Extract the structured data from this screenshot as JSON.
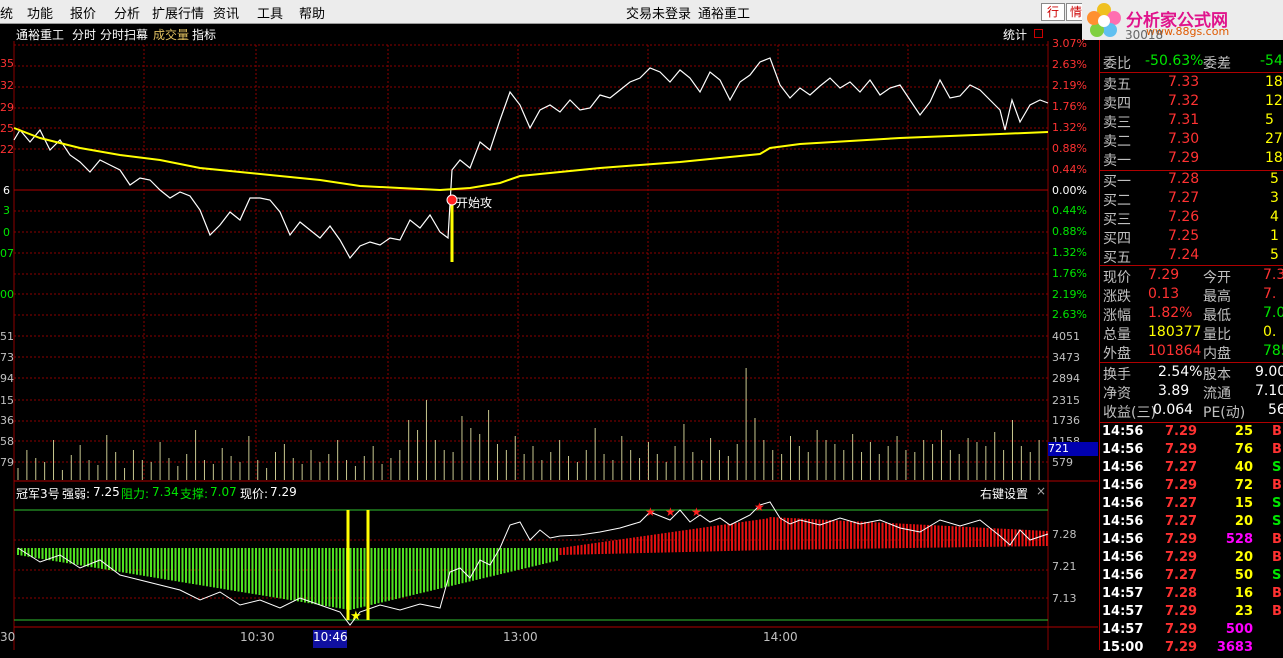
{
  "menu": {
    "items": [
      "统",
      "功能",
      "报价",
      "分析",
      "扩展行情",
      "资讯",
      "工具",
      "帮助"
    ],
    "center_text": [
      "交易未登录",
      "通裕重工"
    ],
    "tabs": [
      "行",
      "情"
    ]
  },
  "logo": {
    "text": "分析家公式网",
    "url": "www.88gs.com"
  },
  "chart_header": {
    "stock": "通裕重工",
    "buttons": [
      "分时",
      "分时扫幕",
      "成交量",
      "指标"
    ],
    "stats": "统计",
    "partial_code": "30018"
  },
  "price_axis": {
    "left": [
      "35",
      "32",
      "29",
      "25",
      "22",
      "6",
      "3",
      "0",
      "07",
      "00"
    ],
    "right": [
      "3.07%",
      "2.63%",
      "2.19%",
      "1.76%",
      "1.32%",
      "0.88%",
      "0.44%",
      "0.00%",
      "0.44%",
      "0.88%",
      "1.32%",
      "1.76%",
      "2.19%",
      "2.63%"
    ]
  },
  "volume_axis": {
    "left": [
      "51",
      "73",
      "94",
      "15",
      "36",
      "58",
      "79"
    ],
    "right": [
      "4051",
      "3473",
      "2894",
      "2315",
      "1736",
      "1158",
      "579"
    ],
    "highlight": "721"
  },
  "annotation": {
    "text": "开始攻"
  },
  "indicator": {
    "name": "冠军3号",
    "strength_label": "强弱:",
    "strength": "7.25",
    "resistance_label": "阻力:",
    "resistance": "7.34",
    "support_label": "支撑:",
    "support": "7.07",
    "price_label": "现价:",
    "price": "7.29",
    "settings": "右键设置",
    "close": "×",
    "axis": [
      "7.28",
      "7.21",
      "7.13"
    ]
  },
  "time_axis": {
    "labels": [
      "30",
      "10:30",
      "10:46",
      "13:00",
      "14:00"
    ]
  },
  "quote": {
    "ratio_row": {
      "label1": "委比",
      "value1": "-50.63%",
      "label2": "委差",
      "value2": "-54"
    },
    "sells": [
      {
        "label": "卖五",
        "price": "7.33",
        "vol": "18"
      },
      {
        "label": "卖四",
        "price": "7.32",
        "vol": "12"
      },
      {
        "label": "卖三",
        "price": "7.31",
        "vol": "5"
      },
      {
        "label": "卖二",
        "price": "7.30",
        "vol": "27"
      },
      {
        "label": "卖一",
        "price": "7.29",
        "vol": "18"
      }
    ],
    "buys": [
      {
        "label": "买一",
        "price": "7.28",
        "vol": "5"
      },
      {
        "label": "买二",
        "price": "7.27",
        "vol": "3"
      },
      {
        "label": "买三",
        "price": "7.26",
        "vol": "4"
      },
      {
        "label": "买四",
        "price": "7.25",
        "vol": "1"
      },
      {
        "label": "买五",
        "price": "7.24",
        "vol": "5"
      }
    ],
    "stats": [
      {
        "l1": "现价",
        "v1": "7.29",
        "l2": "今开",
        "v2": "7.3"
      },
      {
        "l1": "涨跌",
        "v1": "0.13",
        "l2": "最高",
        "v2": "7."
      },
      {
        "l1": "涨幅",
        "v1": "1.82%",
        "l2": "最低",
        "v2": "7.0"
      },
      {
        "l1": "总量",
        "v1": "180377",
        "l2": "量比",
        "v2": "0."
      },
      {
        "l1": "外盘",
        "v1": "101864",
        "l2": "内盘",
        "v2": "785"
      }
    ],
    "stats2": [
      {
        "l1": "换手",
        "v1": "2.54%",
        "l2": "股本",
        "v2": "9.00"
      },
      {
        "l1": "净资",
        "v1": "3.89",
        "l2": "流通",
        "v2": "7.10"
      },
      {
        "l1": "收益(三)",
        "v1": "0.064",
        "l2": "PE(动)",
        "v2": "56"
      }
    ]
  },
  "ticks": [
    {
      "time": "14:56",
      "price": "7.29",
      "vol": "25",
      "side": "B"
    },
    {
      "time": "14:56",
      "price": "7.29",
      "vol": "76",
      "side": "B"
    },
    {
      "time": "14:56",
      "price": "7.27",
      "vol": "40",
      "side": "S"
    },
    {
      "time": "14:56",
      "price": "7.29",
      "vol": "72",
      "side": "B"
    },
    {
      "time": "14:56",
      "price": "7.27",
      "vol": "15",
      "side": "S"
    },
    {
      "time": "14:56",
      "price": "7.27",
      "vol": "20",
      "side": "S"
    },
    {
      "time": "14:56",
      "price": "7.29",
      "vol": "528",
      "side": "B"
    },
    {
      "time": "14:56",
      "price": "7.29",
      "vol": "20",
      "side": "B"
    },
    {
      "time": "14:56",
      "price": "7.27",
      "vol": "50",
      "side": "S"
    },
    {
      "time": "14:57",
      "price": "7.28",
      "vol": "16",
      "side": "B"
    },
    {
      "time": "14:57",
      "price": "7.29",
      "vol": "23",
      "side": "B"
    },
    {
      "time": "14:57",
      "price": "7.29",
      "vol": "500",
      "side": ""
    },
    {
      "time": "15:00",
      "price": "7.29",
      "vol": "3683",
      "side": ""
    }
  ],
  "colors": {
    "up": "#ff3232",
    "down": "#00e600",
    "yellow": "#ffff00",
    "purple": "#ff00ff",
    "grid": "#8b0000"
  }
}
